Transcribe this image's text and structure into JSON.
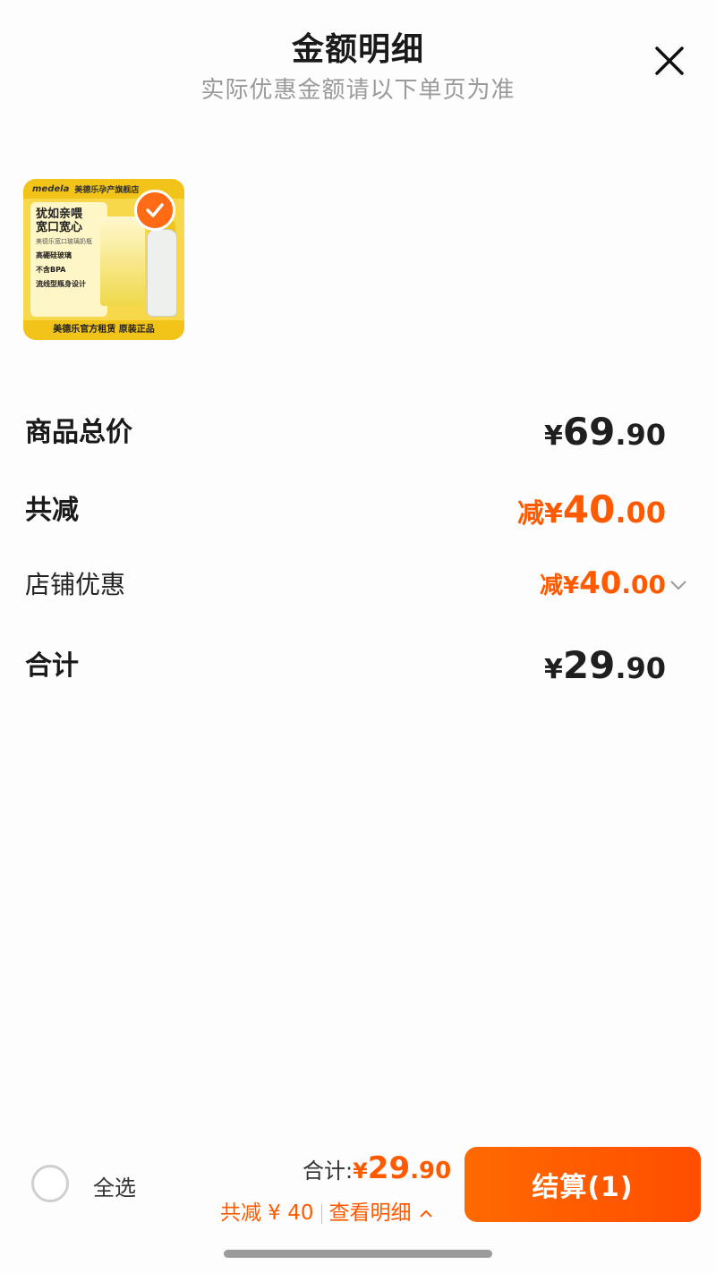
{
  "header": {
    "title": "金额明细",
    "subtitle": "实际优惠金额请以下单页为准"
  },
  "product": {
    "brand": "medela",
    "store": "美德乐孕产旗舰店",
    "headline_1": "犹如亲喂",
    "headline_2": "宽口宽心",
    "product_name": "美德乐宽口玻璃奶瓶",
    "feature_1": "高硼硅玻璃",
    "feature_2": "不含BPA",
    "feature_3": "流线型瓶身设计",
    "footer": "美德乐官方租赁 原装正品",
    "selected": true
  },
  "rows": {
    "goods_total": {
      "label": "商品总价",
      "symbol": "¥",
      "int": "69",
      "dec": ".90"
    },
    "total_reduce": {
      "label": "共减",
      "prefix": "减¥",
      "int": "40",
      "dec": ".00"
    },
    "store_discount": {
      "label": "店铺优惠",
      "prefix": "减¥",
      "int": "40",
      "dec": ".00"
    },
    "sum": {
      "label": "合计",
      "symbol": "¥",
      "int": "29",
      "dec": ".90"
    }
  },
  "bottom_bar": {
    "select_all": "全选",
    "total_label": "合计:",
    "total_symbol": "¥",
    "total_int": "29",
    "total_dec": ".90",
    "discount": "共减 ¥ 40",
    "detail_link": "查看明细",
    "checkout": "结算(1)"
  },
  "colors": {
    "accent": "#ff5a00",
    "text_dark": "#1f1f1f",
    "subtle": "#9a9a9a"
  }
}
